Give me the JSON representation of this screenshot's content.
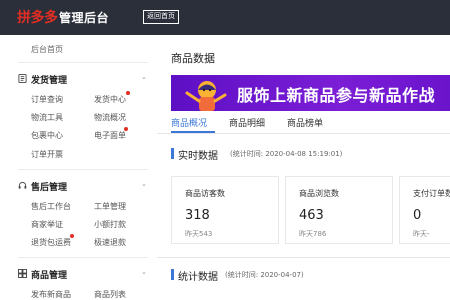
{
  "header": {
    "brand": "拼多多",
    "brand_sub": "管理后台",
    "back_button": "返回首页"
  },
  "sidebar": {
    "home": "后台首页",
    "sections": [
      {
        "title": "发货管理",
        "items": [
          {
            "label": "订单查询",
            "dot": false
          },
          {
            "label": "发货中心",
            "dot": true
          },
          {
            "label": "物流工具",
            "dot": false
          },
          {
            "label": "物流概况",
            "dot": false
          },
          {
            "label": "包裹中心",
            "dot": false
          },
          {
            "label": "电子面单",
            "dot": true
          },
          {
            "label": "订单开票",
            "dot": false
          }
        ]
      },
      {
        "title": "售后管理",
        "items": [
          {
            "label": "售后工作台",
            "dot": false
          },
          {
            "label": "工单管理",
            "dot": false
          },
          {
            "label": "商家举证",
            "dot": false
          },
          {
            "label": "小额打款",
            "dot": false
          },
          {
            "label": "退货包运费",
            "dot": true
          },
          {
            "label": "极速退款",
            "dot": false
          }
        ]
      },
      {
        "title": "商品管理",
        "items": [
          {
            "label": "发布新商品",
            "dot": false
          },
          {
            "label": "商品列表",
            "dot": false
          }
        ]
      }
    ]
  },
  "main": {
    "page_title": "商品数据",
    "banner_text": "服饰上新商品参与新品作战",
    "tabs": [
      "商品概况",
      "商品明细",
      "商品榜单"
    ],
    "active_tab": 0,
    "realtime": {
      "title": "实时数据",
      "time": "(统计时间: 2020-04-08 15:19:01)",
      "stats": [
        {
          "label": "商品访客数",
          "value": "318",
          "yesterday": "昨天543"
        },
        {
          "label": "商品浏览数",
          "value": "463",
          "yesterday": "昨天786"
        },
        {
          "label": "支付订单数",
          "value": "0",
          "yesterday": "昨天-"
        }
      ]
    },
    "stats_section": {
      "title": "统计数据",
      "time": "(统计时间: 2020-04-07)"
    }
  },
  "colors": {
    "topbar": "#2b2f3a",
    "brand_red": "#e02e24",
    "accent_blue": "#3c78d8",
    "banner_purple": "#6a12c8"
  }
}
